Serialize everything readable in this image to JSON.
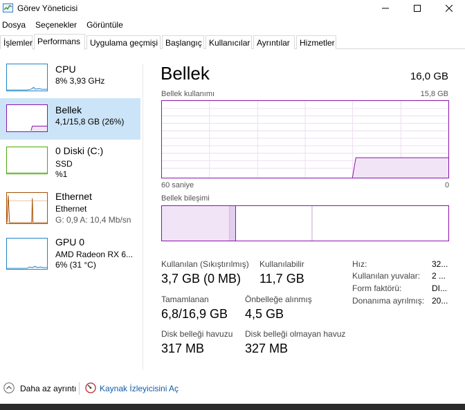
{
  "window": {
    "title": "Görev Yöneticisi",
    "icon": "task-manager-icon"
  },
  "menu": [
    "Dosya",
    "Seçenekler",
    "Görüntüle"
  ],
  "tabs": [
    {
      "label": "İşlemler",
      "active": false
    },
    {
      "label": "Performans",
      "active": true
    },
    {
      "label": "Uygulama geçmişi",
      "active": false
    },
    {
      "label": "Başlangıç",
      "active": false
    },
    {
      "label": "Kullanıcılar",
      "active": false
    },
    {
      "label": "Ayrıntılar",
      "active": false
    },
    {
      "label": "Hizmetler",
      "active": false
    }
  ],
  "resources": [
    {
      "name": "CPU",
      "line1": "8% 3,93 GHz",
      "line2": "",
      "color": "#1e84c9"
    },
    {
      "name": "Bellek",
      "line1": "4,1/15,8 GB (26%)",
      "line2": "",
      "color": "#8b12ae"
    },
    {
      "name": "0 Diski (C:)",
      "line1": "SSD",
      "line2": "%1",
      "color": "#4da60c"
    },
    {
      "name": "Ethernet",
      "line1": "Ethernet",
      "line2": "G: 0,9 A: 10,4 Mb/sn",
      "color": "#a74f01"
    },
    {
      "name": "GPU 0",
      "line1": "AMD Radeon RX 6...",
      "line2": "6% (31 °C)",
      "color": "#1e84c9"
    }
  ],
  "memory": {
    "title": "Bellek",
    "total": "16,0 GB",
    "usage_label": "Bellek kullanımı",
    "usage_max": "15,8 GB",
    "axis_left": "60 saniye",
    "axis_right": "0",
    "composition_label": "Bellek bileşimi",
    "accent": "#8b12ae",
    "usage_fraction": 0.26,
    "stats": {
      "in_use_label": "Kullanılan (Sıkıştırılmış)",
      "in_use_value": "3,7 GB (0 MB)",
      "available_label": "Kullanılabilir",
      "available_value": "11,7 GB",
      "committed_label": "Tamamlanan",
      "committed_value": "6,8/16,9 GB",
      "cached_label": "Önbelleğe alınmış",
      "cached_value": "4,5 GB",
      "paged_label": "Disk belleği havuzu",
      "paged_value": "317 MB",
      "nonpaged_label": "Disk belleği olmayan havuz",
      "nonpaged_value": "327 MB"
    },
    "details": [
      {
        "label": "Hız:",
        "value": "32..."
      },
      {
        "label": "Kullanılan yuvalar:",
        "value": "2 ..."
      },
      {
        "label": "Form faktörü:",
        "value": "DI..."
      },
      {
        "label": "Donanıma ayrılmış:",
        "value": "20..."
      }
    ]
  },
  "footer": {
    "fewer_details": "Daha az ayrıntı",
    "resource_monitor": "Kaynak İzleyicisini Aç"
  }
}
